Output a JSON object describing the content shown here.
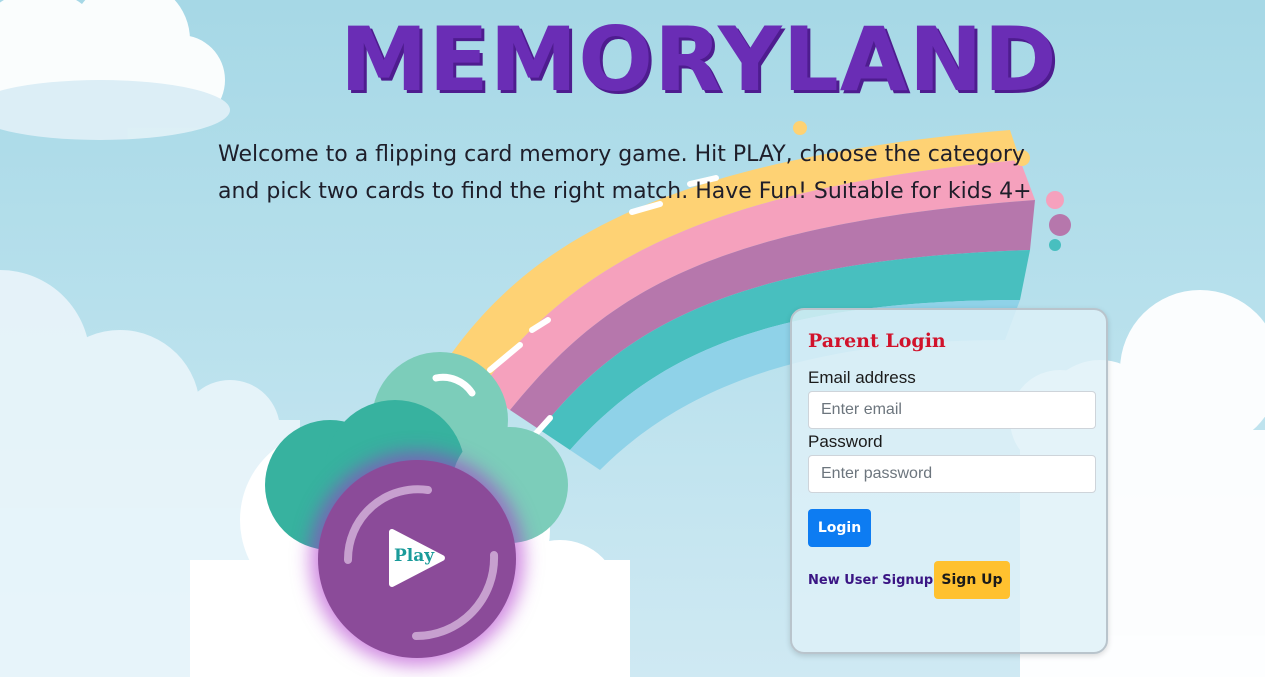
{
  "header": {
    "title": "MEMORYLAND",
    "intro": "Welcome to a flipping card memory game. Hit PLAY, choose the category and pick two cards to find the right match. Have Fun! Suitable for kids 4+"
  },
  "play": {
    "label": "Play",
    "icon": "play-icon"
  },
  "login": {
    "title": "Parent Login",
    "email_label": "Email address",
    "email_placeholder": "Enter email",
    "password_label": "Password",
    "password_placeholder": "Enter password",
    "login_button": "Login",
    "signup_text": "New User Signup",
    "signup_button": "Sign Up"
  },
  "colors": {
    "title": "#6a2db5",
    "login_title": "#d1122b",
    "login_button": "#0d7cf2",
    "signup_button": "#ffc12f",
    "signup_text": "#3a1584",
    "play_circle": "#8b4b99",
    "play_label": "#1a9b9a"
  }
}
